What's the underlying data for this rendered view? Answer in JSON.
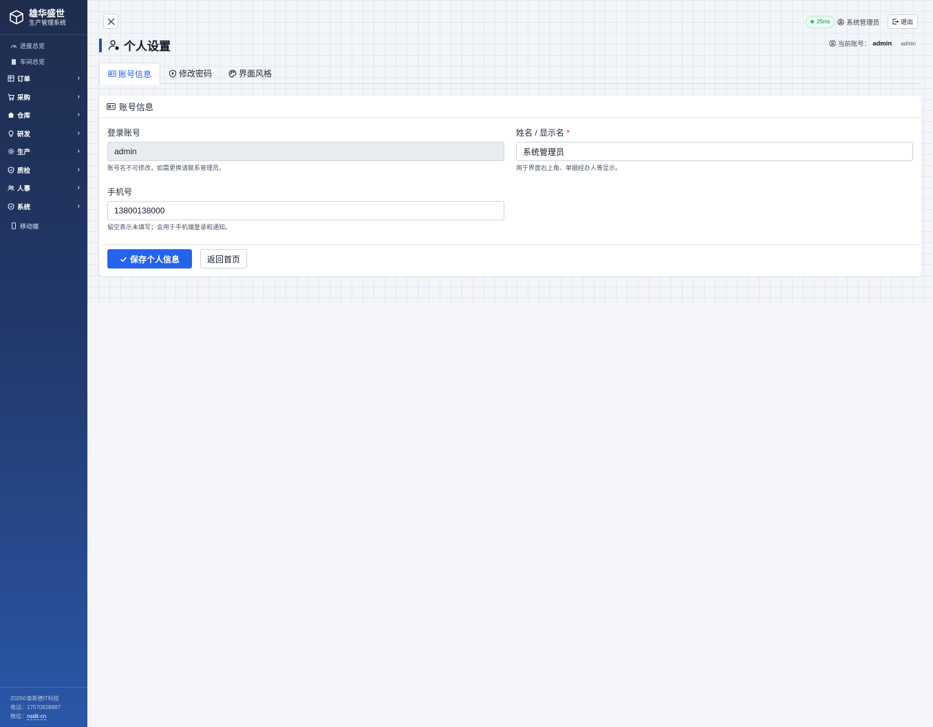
{
  "brand": {
    "name": "雄华盛世",
    "subtitle": "生产管理系统"
  },
  "sidebar": {
    "items": [
      {
        "label": "进度总览",
        "icon": "gauge-icon",
        "kind": "plain"
      },
      {
        "label": "车间总览",
        "icon": "building-icon",
        "kind": "plain"
      },
      {
        "label": "订单",
        "icon": "table-icon",
        "kind": "group"
      },
      {
        "label": "采购",
        "icon": "cart-icon",
        "kind": "group"
      },
      {
        "label": "仓库",
        "icon": "house-icon",
        "kind": "group"
      },
      {
        "label": "研发",
        "icon": "bulb-icon",
        "kind": "group"
      },
      {
        "label": "生产",
        "icon": "gear-icon",
        "kind": "group"
      },
      {
        "label": "质检",
        "icon": "shield-icon",
        "kind": "group"
      },
      {
        "label": "人事",
        "icon": "people-icon",
        "kind": "group"
      },
      {
        "label": "系统",
        "icon": "shield-icon",
        "kind": "group"
      }
    ],
    "mobile": "移动端",
    "footer": {
      "copyright": "2026©泰斯德IT科技",
      "phone": "电话：17570828887",
      "wechat_label": "微信：",
      "wechat": "nsdit-cn"
    }
  },
  "topbar": {
    "ping": "25ms",
    "user": "系统管理员",
    "logout": "退出"
  },
  "page": {
    "title": "个人设置",
    "current_account_label": "当前账号：",
    "current_account": "admin",
    "account_badge": "admin"
  },
  "tabs": [
    {
      "label": "账号信息",
      "active": true
    },
    {
      "label": "修改密码",
      "active": false
    },
    {
      "label": "界面风格",
      "active": false
    }
  ],
  "card": {
    "title": "账号信息",
    "login": {
      "label": "登录账号",
      "value": "admin",
      "help": "账号名不可修改，如需更换请联系管理员。"
    },
    "name": {
      "label": "姓名 / 显示名",
      "required": "*",
      "value": "系统管理员",
      "help": "用于界面右上角、单据经办人等显示。"
    },
    "phone": {
      "label": "手机号",
      "value": "13800138000",
      "help": "留空表示未填写；会用于手机端登录和通知。"
    },
    "save": "保存个人信息",
    "back": "返回首页"
  },
  "colors": {
    "primary": "#2563eb",
    "sidebar_top": "#1f2d4d",
    "sidebar_bottom": "#2a57a8",
    "ok": "#22c55e"
  }
}
